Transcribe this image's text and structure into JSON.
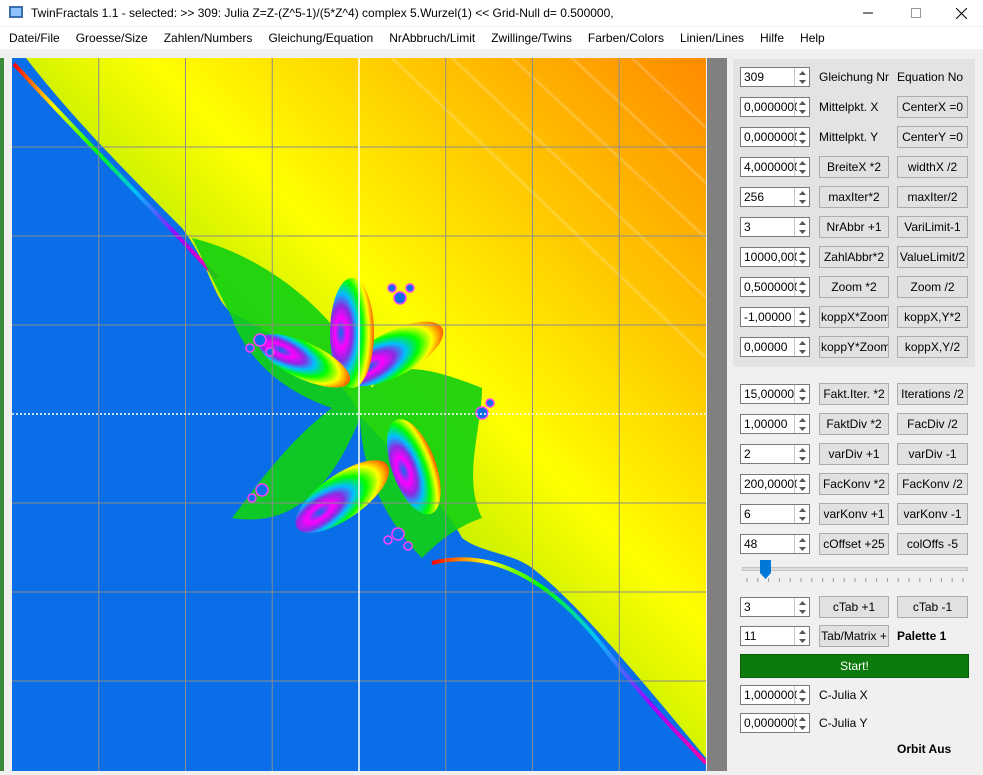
{
  "window": {
    "title": "TwinFractals 1.1 - selected: >> 309: Julia Z=Z-(Z^5-1)/(5*Z^4) complex 5.Wurzel(1) << Grid-Null d= 0.500000,"
  },
  "menu": [
    "Datei/File",
    "Groesse/Size",
    "Zahlen/Numbers",
    "Gleichung/Equation",
    "NrAbbruch/Limit",
    "Zwillinge/Twins",
    "Farben/Colors",
    "Linien/Lines",
    "Hilfe",
    "Help"
  ],
  "panel1": [
    {
      "value": "309",
      "left": "Gleichung Nr",
      "right": "Equation No",
      "left_is_button": false,
      "right_is_button": false
    },
    {
      "value": "0,0000000",
      "left": "Mittelpkt. X",
      "right": "CenterX =0",
      "left_is_button": false,
      "right_is_button": true
    },
    {
      "value": "0,0000000",
      "left": "Mittelpkt. Y",
      "right": "CenterY =0",
      "left_is_button": false,
      "right_is_button": true
    },
    {
      "value": "4,0000000",
      "left": "BreiteX *2",
      "right": "widthX /2",
      "left_is_button": true,
      "right_is_button": true
    },
    {
      "value": "256",
      "left": "maxIter*2",
      "right": "maxIter/2",
      "left_is_button": true,
      "right_is_button": true
    },
    {
      "value": "3",
      "left": "NrAbbr +1",
      "right": "VariLimit-1",
      "left_is_button": true,
      "right_is_button": true
    },
    {
      "value": "10000,000",
      "left": "ZahlAbbr*2",
      "right": "ValueLimit/2",
      "left_is_button": true,
      "right_is_button": true
    },
    {
      "value": "0,5000000",
      "left": "Zoom *2",
      "right": "Zoom /2",
      "left_is_button": true,
      "right_is_button": true
    },
    {
      "value": "-1,00000",
      "left": "koppX*Zoom",
      "right": "koppX,Y*2",
      "left_is_button": true,
      "right_is_button": true
    },
    {
      "value": "0,00000",
      "left": "koppY*Zoom",
      "right": "koppX,Y/2",
      "left_is_button": true,
      "right_is_button": true
    }
  ],
  "panel2": [
    {
      "value": "15,00000",
      "left": "Fakt.Iter. *2",
      "right": "Iterations /2"
    },
    {
      "value": "1,00000",
      "left": "FaktDiv *2",
      "right": "FacDiv /2"
    },
    {
      "value": "2",
      "left": "varDiv +1",
      "right": "varDiv -1"
    },
    {
      "value": "200,00000",
      "left": "FacKonv *2",
      "right": "FacKonv /2"
    },
    {
      "value": "6",
      "left": "varKonv +1",
      "right": "varKonv -1"
    },
    {
      "value": "48",
      "left": "cOffset +25",
      "right": "colOffs -5"
    }
  ],
  "slider": {
    "position": 0.08
  },
  "ctab": {
    "value": "3",
    "plus": "cTab +1",
    "minus": "cTab -1"
  },
  "tab_matrix": {
    "value": "11",
    "button": "Tab/Matrix +",
    "palette_label": "Palette 1"
  },
  "start_label": "Start!",
  "julia": [
    {
      "value": "1,0000000",
      "label": "C-Julia X"
    },
    {
      "value": "0,0000000",
      "label": "C-Julia Y"
    }
  ],
  "orbit_label": "Orbit Aus",
  "colors": {
    "start": "#0d7a0d",
    "fractal_blue": "#0a6ee8"
  }
}
